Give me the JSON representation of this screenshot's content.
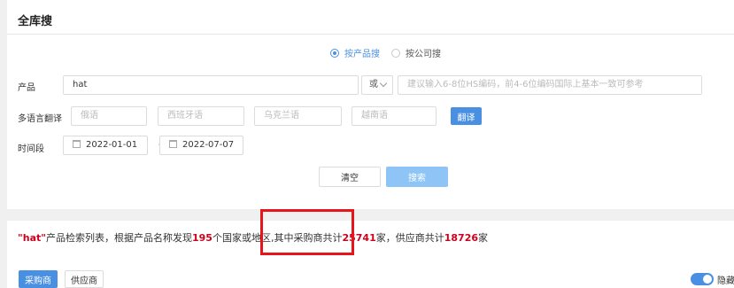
{
  "page_title": "全库搜",
  "search_mode": {
    "options": [
      {
        "label": "按产品搜",
        "selected": true
      },
      {
        "label": "按公司搜",
        "selected": false
      }
    ]
  },
  "product": {
    "label": "产品",
    "value": "hat",
    "operator": "或",
    "hs_placeholder": "建议输入6-8位HS编码，前4-6位编码国际上基本一致可参考"
  },
  "translation": {
    "label": "多语言翻译",
    "fields": [
      "俄语",
      "西班牙语",
      "乌克兰语",
      "越南语"
    ],
    "translate_button": "翻译"
  },
  "period": {
    "label": "时间段",
    "start": "2022-01-01",
    "separator": "-",
    "end": "2022-07-07"
  },
  "actions": {
    "clear": "清空",
    "search": "搜索"
  },
  "summary": {
    "q_open": "\"",
    "keyword": "hat",
    "q_close": "\"",
    "t1": "产品检索列表，根据产品名称发现",
    "countries": "195",
    "t2": "个国家或地区,其中采购商共计",
    "buyers": "25741",
    "t3": "家，供应商共计",
    "suppliers": "18726",
    "t4": "家"
  },
  "tabs": {
    "buyers": "采购商",
    "suppliers": "供应商"
  },
  "toggle": {
    "label": "隐藏",
    "on": true
  },
  "colors": {
    "accent": "#4a90e2",
    "highlight": "#d0021b",
    "annotation_box": "#e8141b"
  }
}
